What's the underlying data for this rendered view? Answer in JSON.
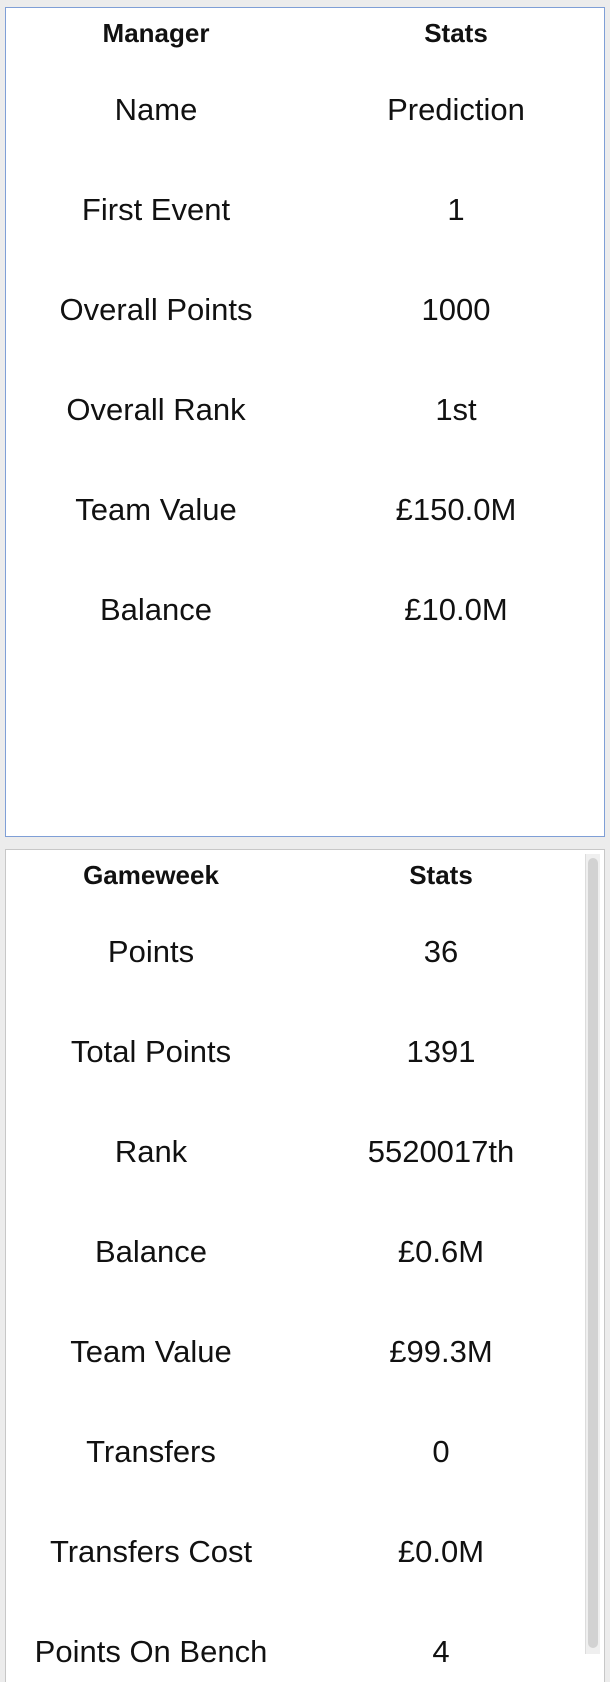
{
  "manager": {
    "headers": [
      "Manager",
      "Stats"
    ],
    "rows": [
      {
        "label": "Name",
        "value": "Prediction"
      },
      {
        "label": "First Event",
        "value": "1"
      },
      {
        "label": "Overall Points",
        "value": "1000"
      },
      {
        "label": "Overall Rank",
        "value": "1st"
      },
      {
        "label": "Team Value",
        "value": "£150.0M"
      },
      {
        "label": "Balance",
        "value": "£10.0M"
      }
    ]
  },
  "gameweek": {
    "headers": [
      "Gameweek",
      "Stats"
    ],
    "rows": [
      {
        "label": "Points",
        "value": "36"
      },
      {
        "label": "Total Points",
        "value": "1391"
      },
      {
        "label": "Rank",
        "value": "5520017th"
      },
      {
        "label": "Balance",
        "value": "£0.6M"
      },
      {
        "label": "Team Value",
        "value": "£99.3M"
      },
      {
        "label": "Transfers",
        "value": "0"
      },
      {
        "label": "Transfers Cost",
        "value": "£0.0M"
      },
      {
        "label": "Points On Bench",
        "value": "4"
      }
    ]
  }
}
